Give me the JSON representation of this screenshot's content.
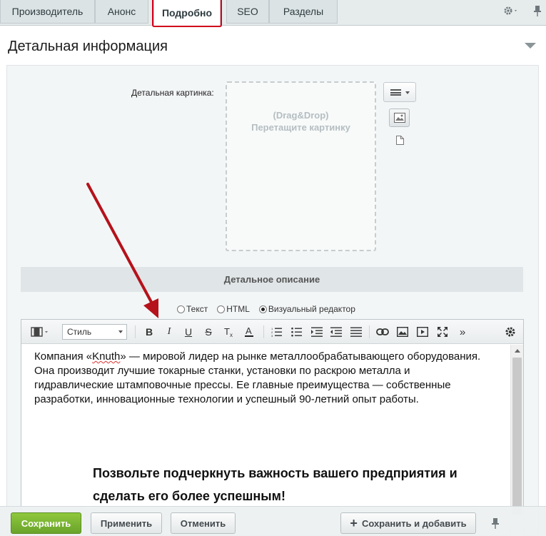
{
  "tabs": [
    {
      "label": "Производитель"
    },
    {
      "label": "Анонс"
    },
    {
      "label": "Подробно"
    },
    {
      "label": "SEO"
    },
    {
      "label": "Разделы"
    }
  ],
  "section": {
    "title": "Детальная информация"
  },
  "picture": {
    "label": "Детальная картинка:",
    "drop_line1": "(Drag&Drop)",
    "drop_line2": "Перетащите картинку"
  },
  "description": {
    "header": "Детальное описание",
    "modes": [
      "Текст",
      "HTML",
      "Визуальный редактор"
    ],
    "selected_mode": "Визуальный редактор"
  },
  "editor": {
    "style_select": "Стиль",
    "toolbar_more": "»",
    "content_p1_before": "Компания «",
    "content_p1_spell": "Knuth",
    "content_p1_after": "» — мировой лидер на рынке металлообрабатывающего оборудования. Она производит лучшие токарные станки, установки по раскрою металла и гидравлические штамповочные прессы. Ее главные преимущества — собственные разработки, инновационные технологии и успешный 90-летний опыт работы.",
    "content_heading": "Позвольте подчеркнуть важность вашего предприятия и сделать его более успешным!"
  },
  "footer": {
    "save": "Сохранить",
    "apply": "Применить",
    "cancel": "Отменить",
    "save_add": "Сохранить и добавить"
  },
  "colors": {
    "highlight": "#d0021b",
    "save_button": "#7ab534",
    "annotation_arrow": "#b5121b"
  }
}
